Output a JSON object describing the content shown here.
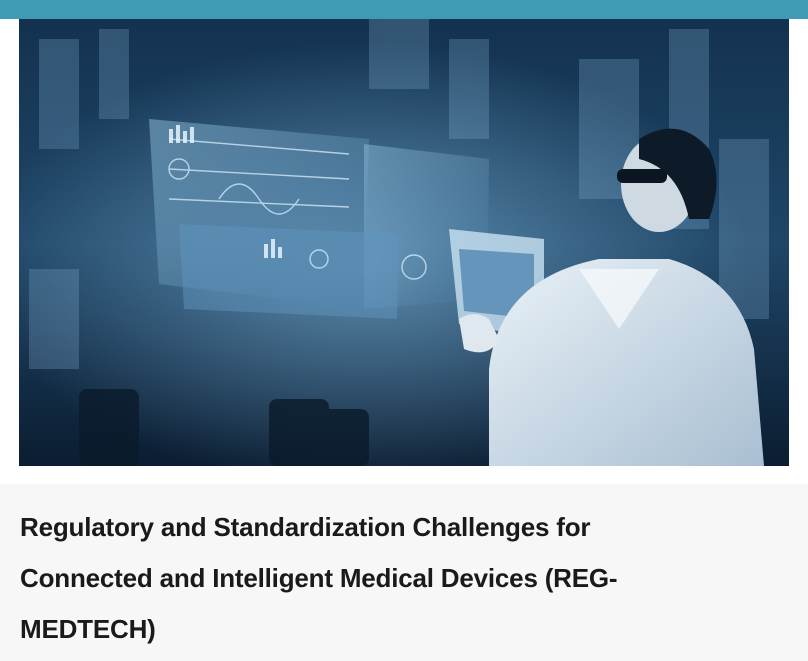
{
  "colors": {
    "top_bar": "#3f9ab4",
    "page_background": "#f7f7f7",
    "title_text": "#1a1a1a"
  },
  "hero_image": {
    "description_icon": "futuristic-hologram-scientist-image"
  },
  "article": {
    "title_line_1": "Regulatory and Standardization Challenges for",
    "title_line_2": "Connected and Intelligent Medical Devices (REG-",
    "title_line_3": "MEDTECH)"
  }
}
